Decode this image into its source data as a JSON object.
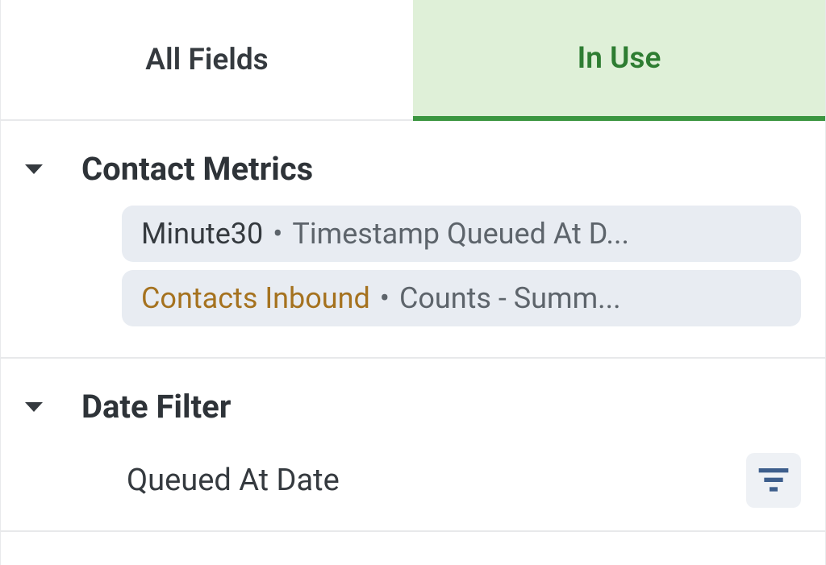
{
  "tabs": {
    "all_fields": "All Fields",
    "in_use": "In Use"
  },
  "sections": {
    "contact_metrics": {
      "title": "Contact Metrics",
      "items": [
        {
          "primary": "Minute30",
          "secondary": "Timestamp Queued At D..."
        },
        {
          "primary": "Contacts Inbound",
          "secondary": "Counts - Summ..."
        }
      ]
    },
    "date_filter": {
      "title": "Date Filter",
      "field_label": "Queued At Date"
    }
  },
  "colors": {
    "accent_green": "#3b9640",
    "accent_orange": "#a5721f",
    "pill_bg": "#e8ecf2"
  }
}
